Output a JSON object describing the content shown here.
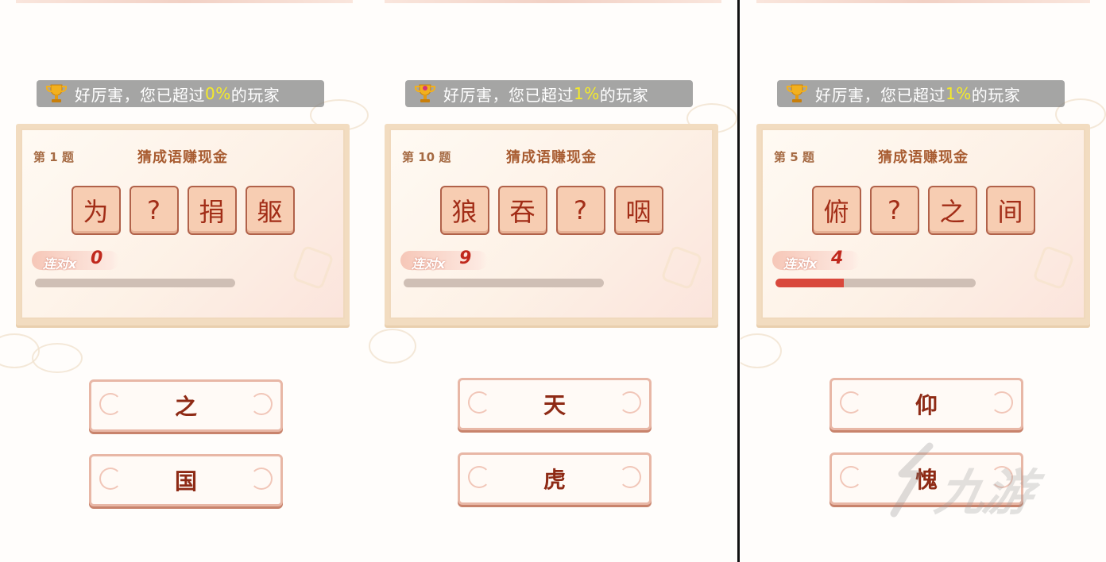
{
  "panels": [
    {
      "banner": {
        "prefix": "好厉害，您已超过",
        "percent": "0%",
        "suffix": "的玩家"
      },
      "question_label": "第 1 题",
      "title": "猜成语赚现金",
      "tiles": [
        "为",
        "?",
        "捐",
        "躯"
      ],
      "combo_label": "连对x",
      "combo_count": "0",
      "progress_fraction": 0.0,
      "options": [
        "之",
        "国"
      ]
    },
    {
      "banner": {
        "prefix": "好厉害，您已超过",
        "percent": "1%",
        "suffix": "的玩家"
      },
      "question_label": "第 10 题",
      "title": "猜成语赚现金",
      "tiles": [
        "狼",
        "吞",
        "?",
        "咽"
      ],
      "combo_label": "连对x",
      "combo_count": "9",
      "progress_fraction": 0.0,
      "options": [
        "天",
        "虎"
      ]
    },
    {
      "banner": {
        "prefix": "好厉害，您已超过",
        "percent": "1%",
        "suffix": "的玩家"
      },
      "question_label": "第 5 题",
      "title": "猜成语赚现金",
      "tiles": [
        "俯",
        "?",
        "之",
        "间"
      ],
      "combo_label": "连对x",
      "combo_count": "4",
      "progress_fraction": 0.34,
      "options": [
        "仰",
        "愧"
      ]
    }
  ],
  "watermark": {
    "text": "九游"
  },
  "colors": {
    "accent": "#d9483c",
    "tile_bg": "#f7cdb2",
    "tile_text": "#a22d17",
    "banner_highlight": "#f4ea2a"
  }
}
